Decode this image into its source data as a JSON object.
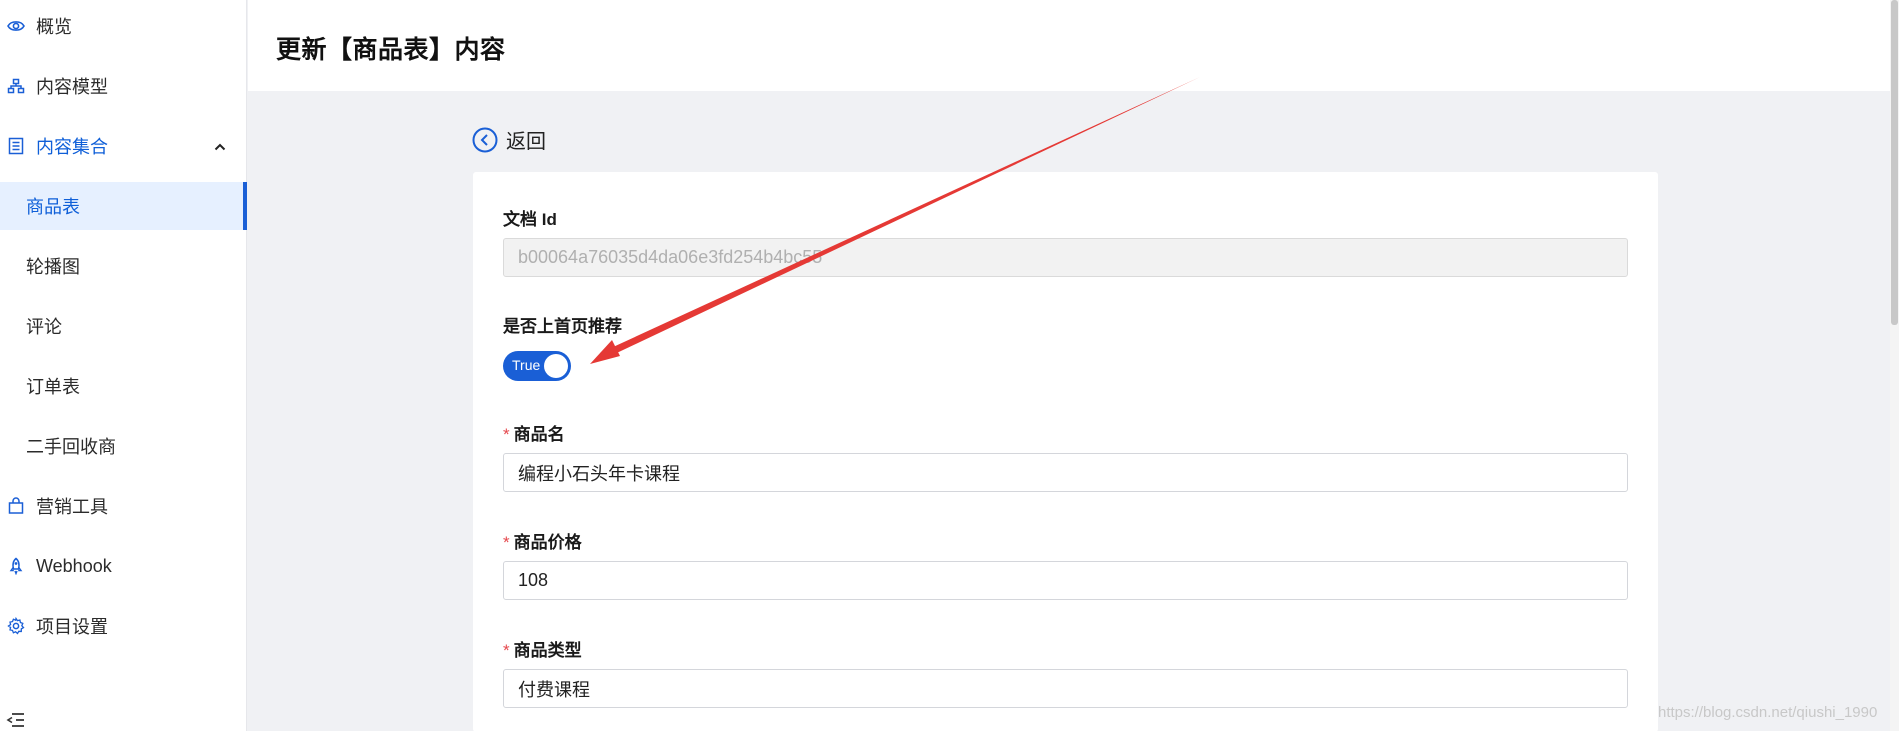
{
  "sidebar": {
    "items": [
      {
        "label": "概览",
        "icon": "eye-icon"
      },
      {
        "label": "内容模型",
        "icon": "model-icon"
      },
      {
        "label": "内容集合",
        "icon": "collection-icon",
        "expanded": true
      },
      {
        "label": "商品表"
      },
      {
        "label": "轮播图"
      },
      {
        "label": "评论"
      },
      {
        "label": "订单表"
      },
      {
        "label": "二手回收商"
      },
      {
        "label": "营销工具",
        "icon": "bag-icon"
      },
      {
        "label": "Webhook",
        "icon": "rocket-icon"
      },
      {
        "label": "项目设置",
        "icon": "gear-icon"
      }
    ],
    "active_item": "商品表"
  },
  "header": {
    "title": "更新【商品表】内容"
  },
  "back": {
    "label": "返回"
  },
  "form": {
    "doc_id": {
      "label": "文档 Id",
      "value": "b00064a76035d4da06e3fd254b4bc55"
    },
    "homepage": {
      "label": "是否上首页推荐",
      "value_label": "True",
      "checked": true
    },
    "name": {
      "label": "商品名",
      "required_mark": "*",
      "value": "编程小石头年卡课程"
    },
    "price": {
      "label": "商品价格",
      "required_mark": "*",
      "value": "108"
    },
    "type": {
      "label": "商品类型",
      "required_mark": "*",
      "value": "付费课程"
    }
  },
  "watermark": "https://blog.csdn.net/qiushi_1990",
  "colors": {
    "accent": "#1a5fd6",
    "arrow": "#e53935",
    "required": "#e5484d"
  }
}
